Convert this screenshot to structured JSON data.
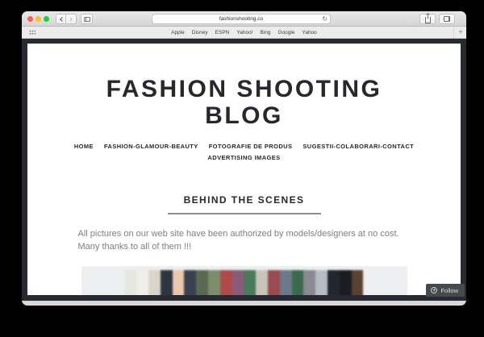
{
  "browser": {
    "url": "fashionshooting.co",
    "reload_icon": "↻",
    "bookmarks": [
      "Apple",
      "Disney",
      "ESPN",
      "Yahoo!",
      "Bing",
      "Google",
      "Yahoo"
    ],
    "new_tab_label": "+"
  },
  "page": {
    "site_title_line1": "FASHION SHOOTING",
    "site_title_line2": "BLOG",
    "nav_row1": [
      "HOME",
      "FASHION-GLAMOUR-BEAUTY",
      "FOTOGRAFIE DE PRODUS",
      "SUGESTII-COLABORARI-CONTACT"
    ],
    "nav_row2": [
      "ADVERTISING IMAGES"
    ],
    "post": {
      "title": "BEHIND THE SCENES",
      "body_line1": "All pictures on our web site have been authorized by models/designers at no cost.",
      "body_line2": "Many thanks to all of them !!!",
      "photo_stripes": [
        "#e6e8e0",
        "#f1efe9",
        "#d9d5c9",
        "#2e3440",
        "#e9c9ad",
        "#39414f",
        "#5a6a52",
        "#7c8d6c",
        "#b04a4a",
        "#8a5a7a",
        "#4a7a5a",
        "#c8c4bc",
        "#9a4a52",
        "#6a7a8a",
        "#3a6a4a",
        "#8a8a92",
        "#b8bcc4",
        "#23272d",
        "#1a1e24",
        "#5a4232"
      ]
    },
    "follow": {
      "icon": "+",
      "label": "Follow"
    }
  },
  "colors": {
    "desktop_background": "#000000",
    "traffic_close": "#ff5f57",
    "traffic_minimize": "#febc2e",
    "traffic_zoom": "#28c840",
    "page_frame": "#272b31",
    "heading_text": "#26282e",
    "body_text": "#7f7f7f",
    "media_background": "#edeff0",
    "follow_background": "#47494b"
  }
}
